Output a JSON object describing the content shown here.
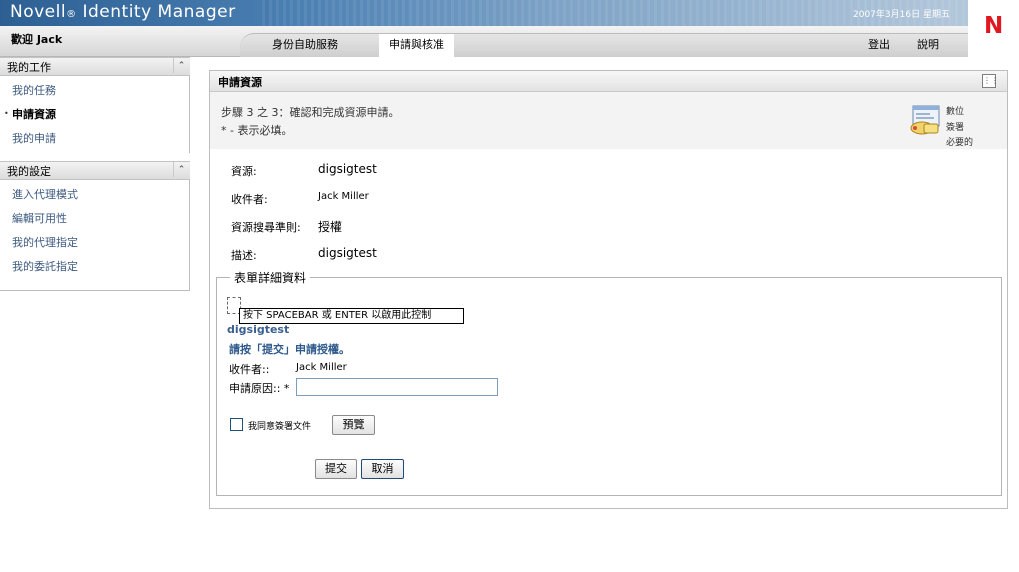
{
  "header": {
    "brand": "Novell",
    "brand_reg": "®",
    "brand_product": " Identity Manager",
    "date": "2007年3月16日 星期五",
    "logo_letter": "N",
    "welcome": "歡迎 Jack",
    "tabs": {
      "self_service": "身份自助服務",
      "request_approve": "申請與核准"
    },
    "logout": "登出",
    "help": "說明"
  },
  "sidebar": {
    "work_title": "我的工作",
    "work_items": [
      "我的任務",
      "申請資源",
      "我的申請"
    ],
    "settings_title": "我的設定",
    "settings_items": [
      "進入代理模式",
      "編輯可用性",
      "我的代理指定",
      "我的委託指定"
    ]
  },
  "panel": {
    "title": "申請資源",
    "step_text": "步驟 3 之 3：確認和完成資源申請。",
    "required_note": "* - 表示必填。",
    "sig_lines": [
      "數位",
      "簽署",
      "必要的"
    ],
    "fields": [
      {
        "label": "資源:",
        "value": "digsigtest"
      },
      {
        "label": "收件者:",
        "value": "Jack Miller"
      },
      {
        "label": "資源搜尋準則:",
        "value": "授權"
      },
      {
        "label": "描述:",
        "value": "digsigtest"
      }
    ]
  },
  "form": {
    "legend": "表單詳細資料",
    "tooltip": "按下 SPACEBAR 或 ENTER 以啟用此控制",
    "resource_name": "digsigtest",
    "instruction": "請按「提交」申請授權。",
    "recipient_label": "收件者::",
    "recipient_value": "Jack Miller",
    "reason_label": "申請原因:: *",
    "reason_value": "",
    "agree_label": "我同意簽署文件",
    "preview": "預覽",
    "submit": "提交",
    "cancel": "取消"
  },
  "colors": {
    "link": "#3d5a80",
    "accent_blue": "#2f5a8c",
    "logo_red": "#e0171e"
  }
}
